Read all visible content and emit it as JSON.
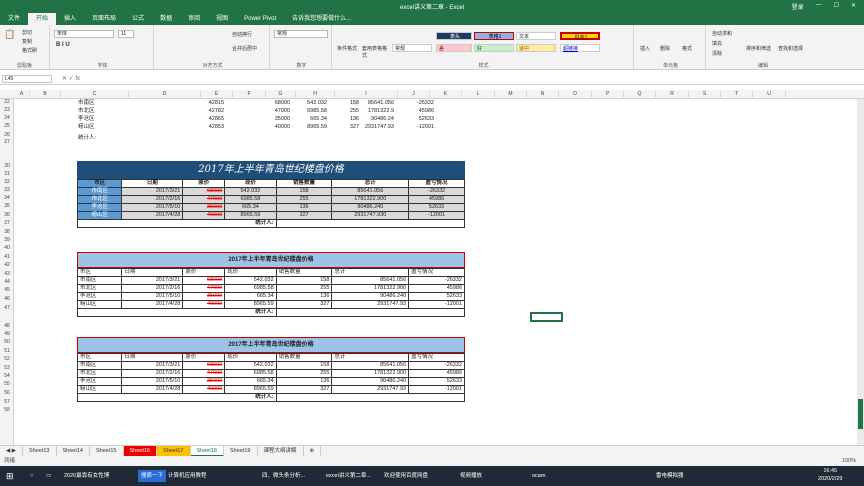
{
  "window": {
    "title": "excel讲义第二章 - Excel",
    "login": "登录",
    "share": "共享"
  },
  "tabs": [
    "文件",
    "开始",
    "插入",
    "页面布局",
    "公式",
    "数据",
    "审阅",
    "视图",
    "Power Pivot",
    "告诉我您想要做什么..."
  ],
  "ribbon": {
    "clipboard": {
      "cut": "剪切",
      "copy": "复制",
      "painter": "格式刷",
      "label": "剪贴板"
    },
    "font": {
      "name": "宋体",
      "size": "11",
      "label": "字体"
    },
    "align": {
      "wrap": "自动换行",
      "merge": "合并后居中",
      "label": "对齐方式"
    },
    "number": {
      "format": "常规",
      "label": "数字"
    },
    "styles": {
      "cond": "条件格式",
      "table": "套用表格格式",
      "label": "样式",
      "items": [
        "表头",
        "表格1",
        "文本",
        "财务1",
        "常规",
        "差",
        "好",
        "适中",
        "超链接"
      ]
    },
    "cells": {
      "insert": "插入",
      "delete": "删除",
      "format": "格式",
      "label": "单元格"
    },
    "editing": {
      "autosum": "自动求和",
      "fill": "填充",
      "clear": "清除",
      "sort": "排序和筛选",
      "find": "查找和选择",
      "label": "编辑"
    }
  },
  "namebox": "L45",
  "columns": [
    "A",
    "B",
    "C",
    "D",
    "E",
    "F",
    "G",
    "H",
    "I",
    "J",
    "K",
    "L",
    "M",
    "N",
    "O",
    "P",
    "Q",
    "R",
    "S",
    "T",
    "U"
  ],
  "rows": [
    "22",
    "23",
    "24",
    "25",
    "26",
    "27",
    "30",
    "31",
    "32",
    "33",
    "34",
    "35",
    "36",
    "37",
    "38",
    "39",
    "40",
    "41",
    "42",
    "43",
    "44",
    "45",
    "46",
    "47",
    "48",
    "49",
    "50",
    "51",
    "52",
    "53",
    "54",
    "55",
    "56",
    "57",
    "58"
  ],
  "top": {
    "rows": [
      [
        "市南区",
        "42815",
        "68000",
        "542.032",
        "158",
        "85641.056",
        "-26332"
      ],
      [
        "市北区",
        "42782",
        "47000",
        "6985.58",
        "255",
        "1781322.9",
        "45986"
      ],
      [
        "李沧区",
        "42865",
        "35000",
        "665.34",
        "136",
        "90486.24",
        "52633"
      ],
      [
        "崂山区",
        "42853",
        "40000",
        "8965.59",
        "327",
        "2931747.93",
        "-12001"
      ]
    ],
    "stat": "统计人:"
  },
  "table1": {
    "title": "2017年上半年青岛世纪楼盘价格",
    "headers": [
      "市区",
      "日期",
      "原价",
      "现价",
      "销售数量",
      "总计",
      "盈亏情况"
    ],
    "rows": [
      [
        "市南区",
        "2017/3/21",
        "68000",
        "542.032",
        "158",
        "85641.056",
        "-26332"
      ],
      [
        "市北区",
        "2017/2/16",
        "47000",
        "6985.58",
        "255",
        "1781322.900",
        "45986"
      ],
      [
        "李沧区",
        "2017/5/10",
        "35000",
        "665.34",
        "136",
        "90486.240",
        "52633"
      ],
      [
        "崂山区",
        "2017/4/28",
        "40000",
        "8965.59",
        "327",
        "2931747.930",
        "-12001"
      ]
    ],
    "stat": "统计人:"
  },
  "table2": {
    "title": "2017年上半年青岛世纪楼盘价格",
    "headers": [
      "市区",
      "日期",
      "原价",
      "现价",
      "销售数量",
      "总计",
      "盈亏情况"
    ],
    "rows": [
      [
        "市南区",
        "2017/3/21",
        "68000",
        "542.032",
        "158",
        "85641.056",
        "-26332"
      ],
      [
        "市北区",
        "2017/2/16",
        "47000",
        "6985.58",
        "255",
        "1781322.900",
        "45986"
      ],
      [
        "李沧区",
        "2017/5/10",
        "35000",
        "665.34",
        "136",
        "90486.240",
        "52633"
      ],
      [
        "崂山区",
        "2017/4/28",
        "40000",
        "8965.59",
        "327",
        "2931747.93",
        "-12001"
      ]
    ],
    "stat": "统计人:"
  },
  "table3": {
    "title": "2017年上半年青岛世纪楼盘价格",
    "headers": [
      "市区",
      "日期",
      "原价",
      "现价",
      "销售数量",
      "总计",
      "盈亏情况"
    ],
    "rows": [
      [
        "市南区",
        "2017/3/21",
        "68000",
        "542.032",
        "158",
        "85641.056",
        "-26332"
      ],
      [
        "市北区",
        "2017/2/16",
        "47000",
        "6985.58",
        "255",
        "1781322.900",
        "45986"
      ],
      [
        "李沧区",
        "2017/5/10",
        "35000",
        "665.34",
        "136",
        "90486.240",
        "52633"
      ],
      [
        "崂山区",
        "2017/4/28",
        "40000",
        "8965.59",
        "327",
        "2931747.93",
        "-12001"
      ]
    ],
    "stat": "统计人:"
  },
  "sheets": [
    "Sheet13",
    "Sheet14",
    "Sheet15",
    "Sheet16",
    "Sheet17",
    "Sheet18",
    "Sheet19",
    "课程大纲讲解"
  ],
  "status": {
    "ready": "就绪",
    "zoom": "100%"
  },
  "taskbar": {
    "items": [
      "2020最靠有女性博",
      "搜索一下",
      "计算机应用教程",
      "四、微头条分析...",
      "excel讲义第二章...",
      "欢迎使用百度网盘",
      "视频播放",
      "ocam",
      "雷电模拟器"
    ],
    "time": "16:45",
    "date": "2020/2/29"
  }
}
